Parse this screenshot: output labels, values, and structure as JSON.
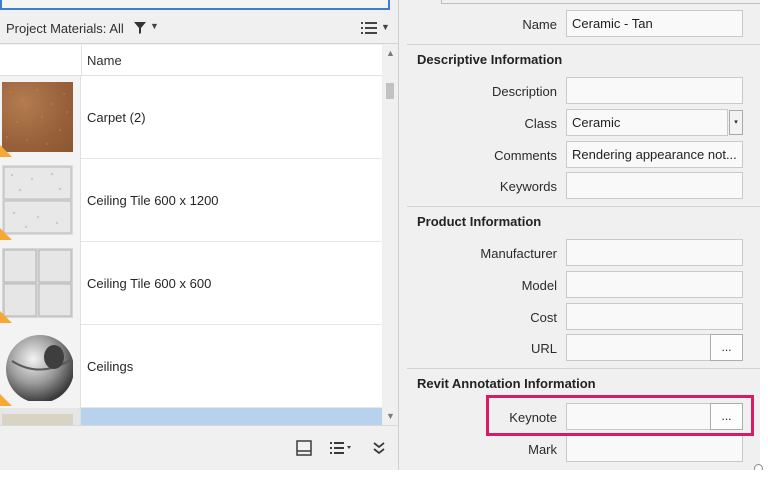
{
  "filter_bar": {
    "label": "Project Materials: All",
    "filter_icon": "filter-funnel-icon",
    "caret_icon": "caret-down-icon",
    "view_icon": "list-view-icon"
  },
  "list": {
    "column_header": "Name",
    "items": [
      {
        "name": "Carpet (2)",
        "thumbnail": "carpet-swatch"
      },
      {
        "name": "Ceiling Tile 600 x 1200",
        "thumbnail": "ceiling-tile-large-swatch"
      },
      {
        "name": "Ceiling Tile 600 x 600",
        "thumbnail": "ceiling-tile-small-swatch"
      },
      {
        "name": "Ceilings",
        "thumbnail": "sphere-swatch"
      },
      {
        "name": "",
        "thumbnail": "partial-swatch",
        "selected": true
      }
    ]
  },
  "bottom_bar": {
    "icons": [
      "panel-toggle-icon",
      "list-options-icon",
      "expand-chevron-icon"
    ]
  },
  "properties": {
    "name": {
      "label": "Name",
      "value": "Ceramic - Tan"
    },
    "sections": {
      "descriptive": {
        "title": "Descriptive Information",
        "description": {
          "label": "Description",
          "value": ""
        },
        "class": {
          "label": "Class",
          "value": "Ceramic"
        },
        "comments": {
          "label": "Comments",
          "value": "Rendering appearance not..."
        },
        "keywords": {
          "label": "Keywords",
          "value": ""
        }
      },
      "product": {
        "title": "Product Information",
        "manufacturer": {
          "label": "Manufacturer",
          "value": ""
        },
        "model": {
          "label": "Model",
          "value": ""
        },
        "cost": {
          "label": "Cost",
          "value": ""
        },
        "url": {
          "label": "URL",
          "value": ""
        }
      },
      "revit": {
        "title": "Revit Annotation Information",
        "keynote": {
          "label": "Keynote",
          "value": ""
        },
        "mark": {
          "label": "Mark",
          "value": ""
        }
      }
    },
    "browse_label": "...",
    "dropdown_glyph": "▾"
  },
  "colors": {
    "highlight": "#d81b66",
    "selection": "#b8d2ee",
    "accent": "#f5a833"
  }
}
